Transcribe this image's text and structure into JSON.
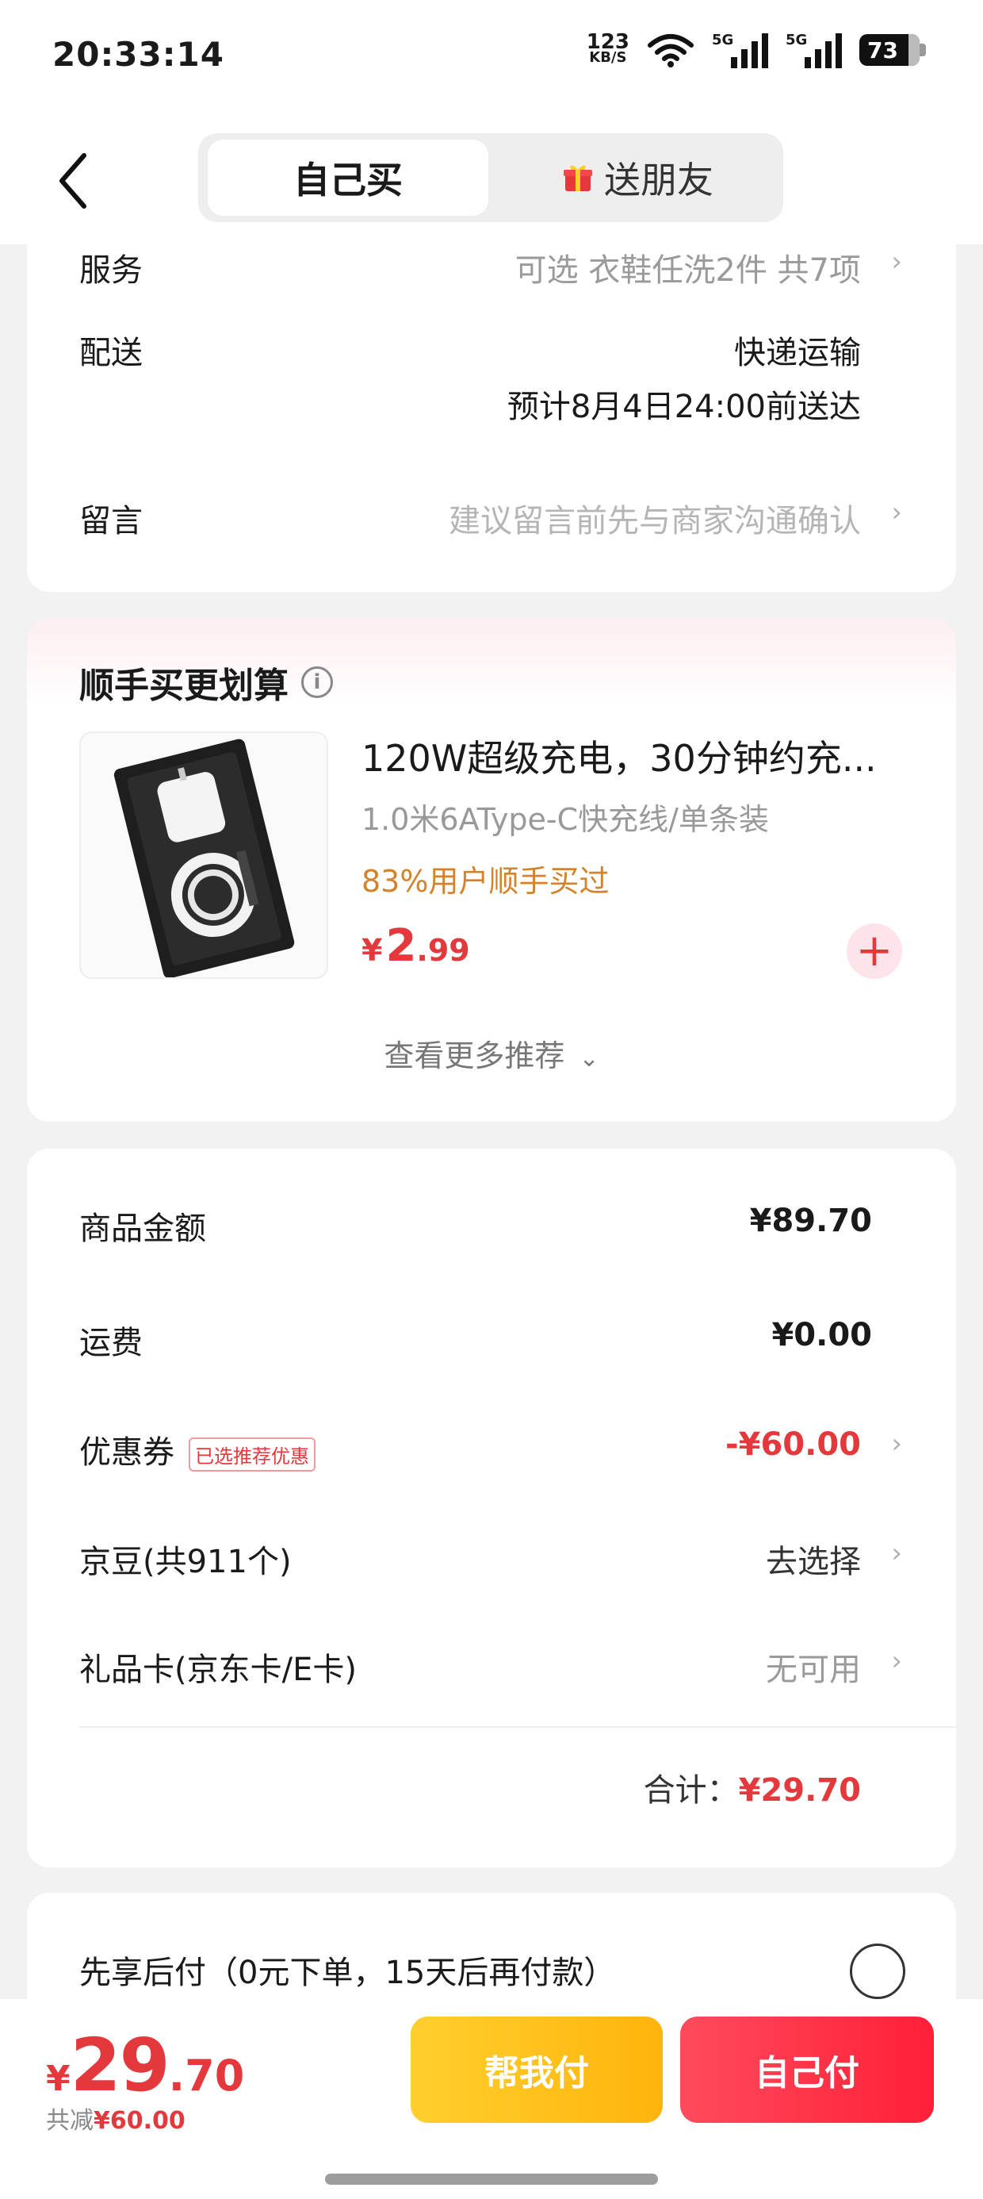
{
  "status_bar": {
    "time": "20:33:14",
    "net_speed_value": "123",
    "net_speed_unit": "KB/S",
    "sim1_label": "5G",
    "sim2_label": "5G",
    "battery": "73"
  },
  "header": {
    "tabs": [
      {
        "label": "自己买",
        "active": true
      },
      {
        "label": "送朋友",
        "active": false
      }
    ]
  },
  "order_info": {
    "service": {
      "label": "服务",
      "value": "可选 衣鞋任洗2件 共7项"
    },
    "delivery": {
      "label": "配送",
      "method": "快递运输",
      "eta": "预计8月4日24:00前送达"
    },
    "note": {
      "label": "留言",
      "placeholder": "建议留言前先与商家沟通确认"
    }
  },
  "addon": {
    "title": "顺手买更划算",
    "product": {
      "title": "120W超级充电，30分钟约充...",
      "spec": "1.0米6AType-C快充线/单条装",
      "bought_pct": "83%用户顺手买过",
      "price_symbol": "¥",
      "price_int": "2",
      "price_dec": ".99"
    },
    "more_label": "查看更多推荐"
  },
  "summary": {
    "goods": {
      "label": "商品金额",
      "value": "¥89.70"
    },
    "shipping": {
      "label": "运费",
      "value": "¥0.00"
    },
    "coupon": {
      "label": "优惠券",
      "tag": "已选推荐优惠",
      "value": "-¥60.00"
    },
    "jd_beans": {
      "label": "京豆(共911个)",
      "value": "去选择"
    },
    "gift_card": {
      "label": "礼品卡(京东卡/E卡)",
      "value": "无可用"
    },
    "total_label": "合计：",
    "total_value": "¥29.70"
  },
  "pay_later": {
    "label": "先享后付（0元下单，15天后再付款）"
  },
  "bottom_bar": {
    "price_symbol": "¥",
    "price_int": "29",
    "price_dec": ".70",
    "saved_label": "共减",
    "saved_value": "¥60.00",
    "help_pay_label": "帮我付",
    "self_pay_label": "自己付"
  },
  "colors": {
    "accent_red": "#e4393c",
    "help_pay_yellow": "#ffb40c",
    "self_pay_red": "#ff1f38",
    "bought_orange": "#d4822c"
  }
}
